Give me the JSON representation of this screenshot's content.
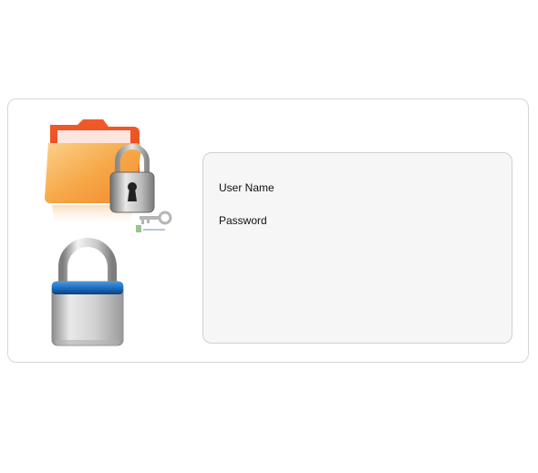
{
  "login": {
    "username_label": "User Name",
    "password_label": "Password"
  },
  "icons": {
    "folder": "folder-lock-icon",
    "padlock": "padlock-icon"
  },
  "colors": {
    "panel_bg": "#f6f6f6",
    "border": "#d6d6d6",
    "folder_orange": "#f08a2c",
    "lock_band_blue": "#1a6fc0"
  }
}
